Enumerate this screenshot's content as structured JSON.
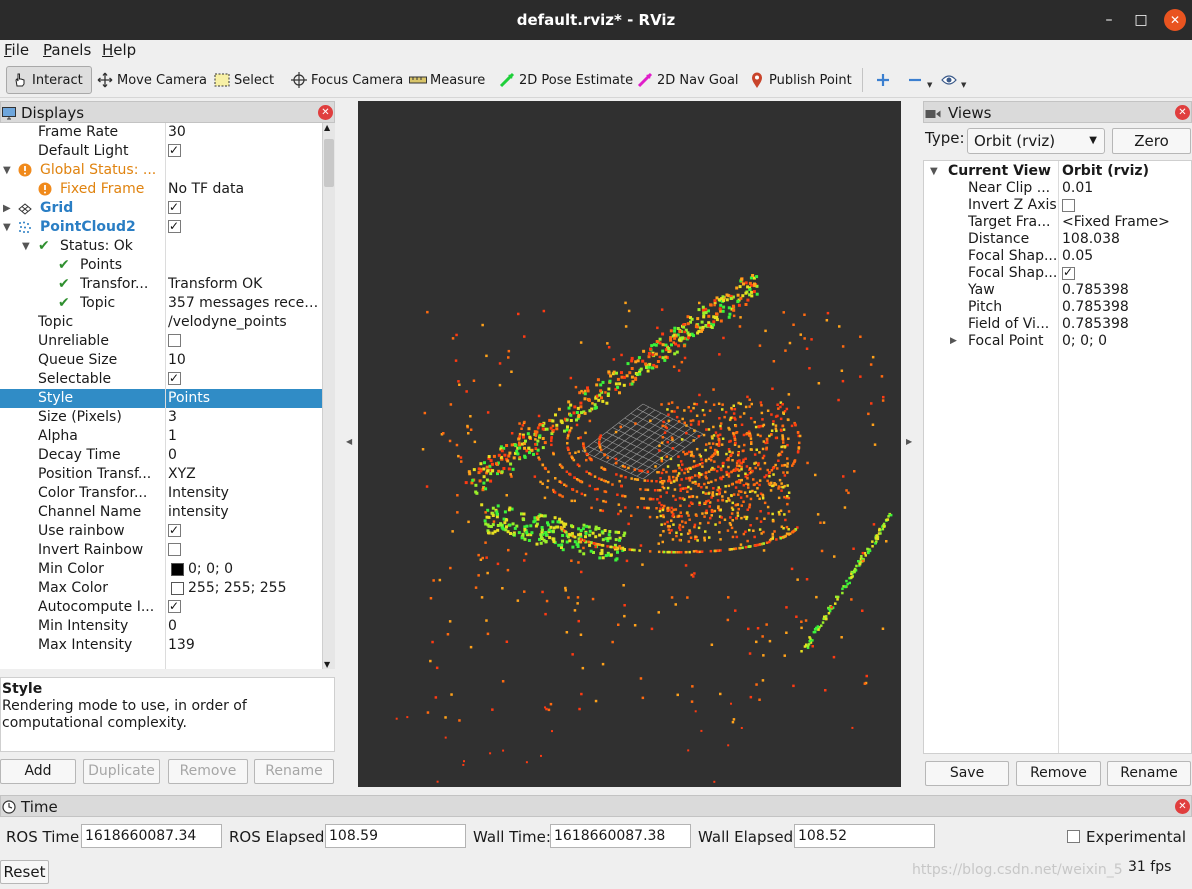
{
  "window": {
    "title": "default.rviz* - RViz"
  },
  "menu": [
    {
      "label": "File",
      "key": "F",
      "rest": "ile"
    },
    {
      "label": "Panels",
      "key": "P",
      "rest": "anels"
    },
    {
      "label": "Help",
      "key": "H",
      "rest": "elp"
    }
  ],
  "toolbar": {
    "interact": "Interact",
    "move_camera": "Move Camera",
    "select": "Select",
    "focus_camera": "Focus Camera",
    "measure": "Measure",
    "pose_estimate": "2D Pose Estimate",
    "nav_goal": "2D Nav Goal",
    "publish_point": "Publish Point"
  },
  "displays": {
    "title": "Displays",
    "rows": [
      {
        "label": "Frame Rate",
        "value": "30"
      },
      {
        "label": "Default Light",
        "value": ""
      },
      {
        "label": "Global Status: ...",
        "value": ""
      },
      {
        "label": "Fixed Frame",
        "value": "No TF data"
      },
      {
        "label": "Grid",
        "value": ""
      },
      {
        "label": "PointCloud2",
        "value": ""
      },
      {
        "label": "Status: Ok",
        "value": ""
      },
      {
        "label": "Points",
        "value": ""
      },
      {
        "label": "Transfor...",
        "value": "Transform OK"
      },
      {
        "label": "Topic",
        "value": "357 messages recei..."
      },
      {
        "label": "Topic",
        "value": "/velodyne_points"
      },
      {
        "label": "Unreliable",
        "value": ""
      },
      {
        "label": "Queue Size",
        "value": "10"
      },
      {
        "label": "Selectable",
        "value": ""
      },
      {
        "label": "Style",
        "value": "Points"
      },
      {
        "label": "Size (Pixels)",
        "value": "3"
      },
      {
        "label": "Alpha",
        "value": "1"
      },
      {
        "label": "Decay Time",
        "value": "0"
      },
      {
        "label": "Position Transf...",
        "value": "XYZ"
      },
      {
        "label": "Color Transfor...",
        "value": "Intensity"
      },
      {
        "label": "Channel Name",
        "value": "intensity"
      },
      {
        "label": "Use rainbow",
        "value": ""
      },
      {
        "label": "Invert Rainbow",
        "value": ""
      },
      {
        "label": "Min Color",
        "value": "0; 0; 0"
      },
      {
        "label": "Max Color",
        "value": "255; 255; 255"
      },
      {
        "label": "Autocompute I...",
        "value": ""
      },
      {
        "label": "Min Intensity",
        "value": "0"
      },
      {
        "label": "Max Intensity",
        "value": "139"
      }
    ],
    "checkboxes": {
      "default_light": true,
      "grid": true,
      "pointcloud2": true,
      "unreliable": false,
      "selectable": true,
      "use_rainbow": true,
      "invert_rainbow": false,
      "autocompute": true
    },
    "selected_row": "Style",
    "description_title": "Style",
    "description_text": "Rendering mode to use, in order of computational complexity.",
    "buttons": {
      "add": "Add",
      "duplicate": "Duplicate",
      "remove": "Remove",
      "rename": "Rename"
    }
  },
  "views": {
    "title": "Views",
    "type_label": "Type:",
    "type_value": "Orbit (rviz)",
    "zero_label": "Zero",
    "header_key": "Current View",
    "header_value": "Orbit (rviz)",
    "rows": [
      {
        "label": "Near Clip ...",
        "value": "0.01"
      },
      {
        "label": "Invert Z Axis",
        "value": ""
      },
      {
        "label": "Target Fra...",
        "value": "<Fixed Frame>"
      },
      {
        "label": "Distance",
        "value": "108.038"
      },
      {
        "label": "Focal Shap...",
        "value": "0.05"
      },
      {
        "label": "Focal Shap...",
        "value": ""
      },
      {
        "label": "Yaw",
        "value": "0.785398"
      },
      {
        "label": "Pitch",
        "value": "0.785398"
      },
      {
        "label": "Field of Vi...",
        "value": "0.785398"
      },
      {
        "label": "Focal Point",
        "value": "0; 0; 0"
      }
    ],
    "checkboxes": {
      "invert_z": false,
      "focal_shape_fixed": true
    },
    "buttons": {
      "save": "Save",
      "remove": "Remove",
      "rename": "Rename"
    }
  },
  "time": {
    "title": "Time",
    "ros_time_label": "ROS Time:",
    "ros_time": "1618660087.34",
    "ros_elapsed_label": "ROS Elapsed:",
    "ros_elapsed": "108.59",
    "wall_time_label": "Wall Time:",
    "wall_time": "1618660087.38",
    "wall_elapsed_label": "Wall Elapsed:",
    "wall_elapsed": "108.52",
    "experimental_label": "Experimental",
    "experimental": false,
    "reset_label": "Reset",
    "fps": "31 fps"
  },
  "watermark": "https://blog.csdn.net/weixin_5"
}
